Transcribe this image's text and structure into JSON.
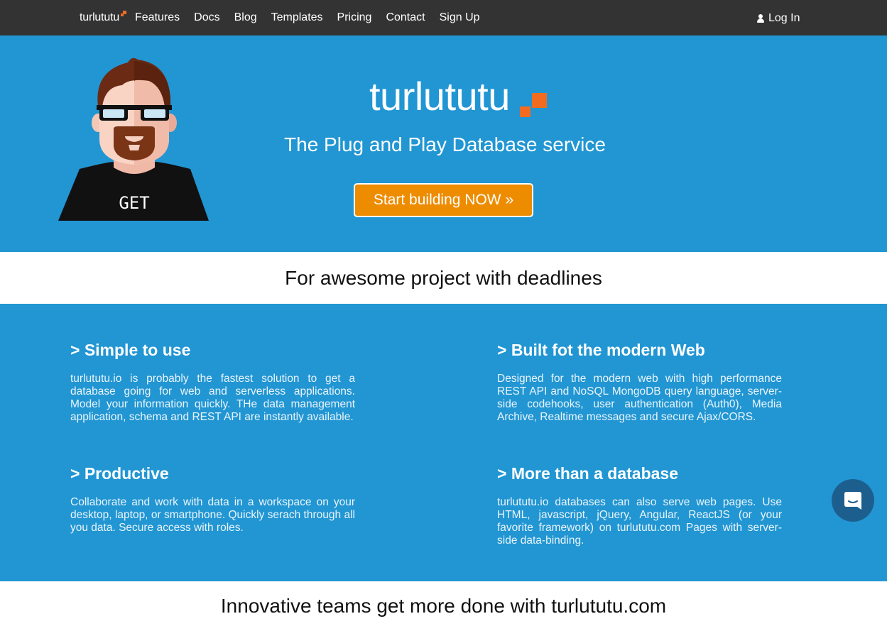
{
  "nav": {
    "brand": "turlututu",
    "links": [
      "Features",
      "Docs",
      "Blog",
      "Templates",
      "Pricing",
      "Contact",
      "Sign Up"
    ],
    "login": "Log In"
  },
  "hero": {
    "logo": "turlututu",
    "tagline": "The Plug and Play Database service",
    "cta": "Start building NOW »",
    "mascot_shirt": "GET"
  },
  "band": {
    "text": "For awesome project with deadlines"
  },
  "features": [
    {
      "title": "> Simple to use",
      "body": "turlututu.io is probably the fastest solution to get a database going for web and serverless applications. Model your information quickly. THe data management application, schema and REST API are instantly available."
    },
    {
      "title": "> Built fot the modern Web",
      "body": "Designed for the modern web with high performance REST API and NoSQL MongoDB query language, server-side codehooks, user authentication (Auth0), Media Archive, Realtime messages and secure Ajax/CORS."
    },
    {
      "title": "> Productive",
      "body": "Collaborate and work with data in a workspace on your desktop, laptop, or smartphone. Quickly serach through all you data. Secure access with roles."
    },
    {
      "title": "> More than a database",
      "body": "turlututu.io databases can also serve web pages. Use HTML, javascript, jQuery, Angular, ReactJS (or your favorite framework) on turlututu.com Pages with server-side data-binding."
    }
  ],
  "bottom": {
    "text": "Innovative teams get more done with turlututu.com"
  },
  "colors": {
    "navbar": "#333333",
    "hero_blue": "#2196d3",
    "accent_orange": "#f26b21",
    "cta_orange": "#ee8c00",
    "chat_button": "#1c5f8f"
  },
  "icons": {
    "login": "user-icon",
    "chat": "chat-bubble-icon"
  }
}
